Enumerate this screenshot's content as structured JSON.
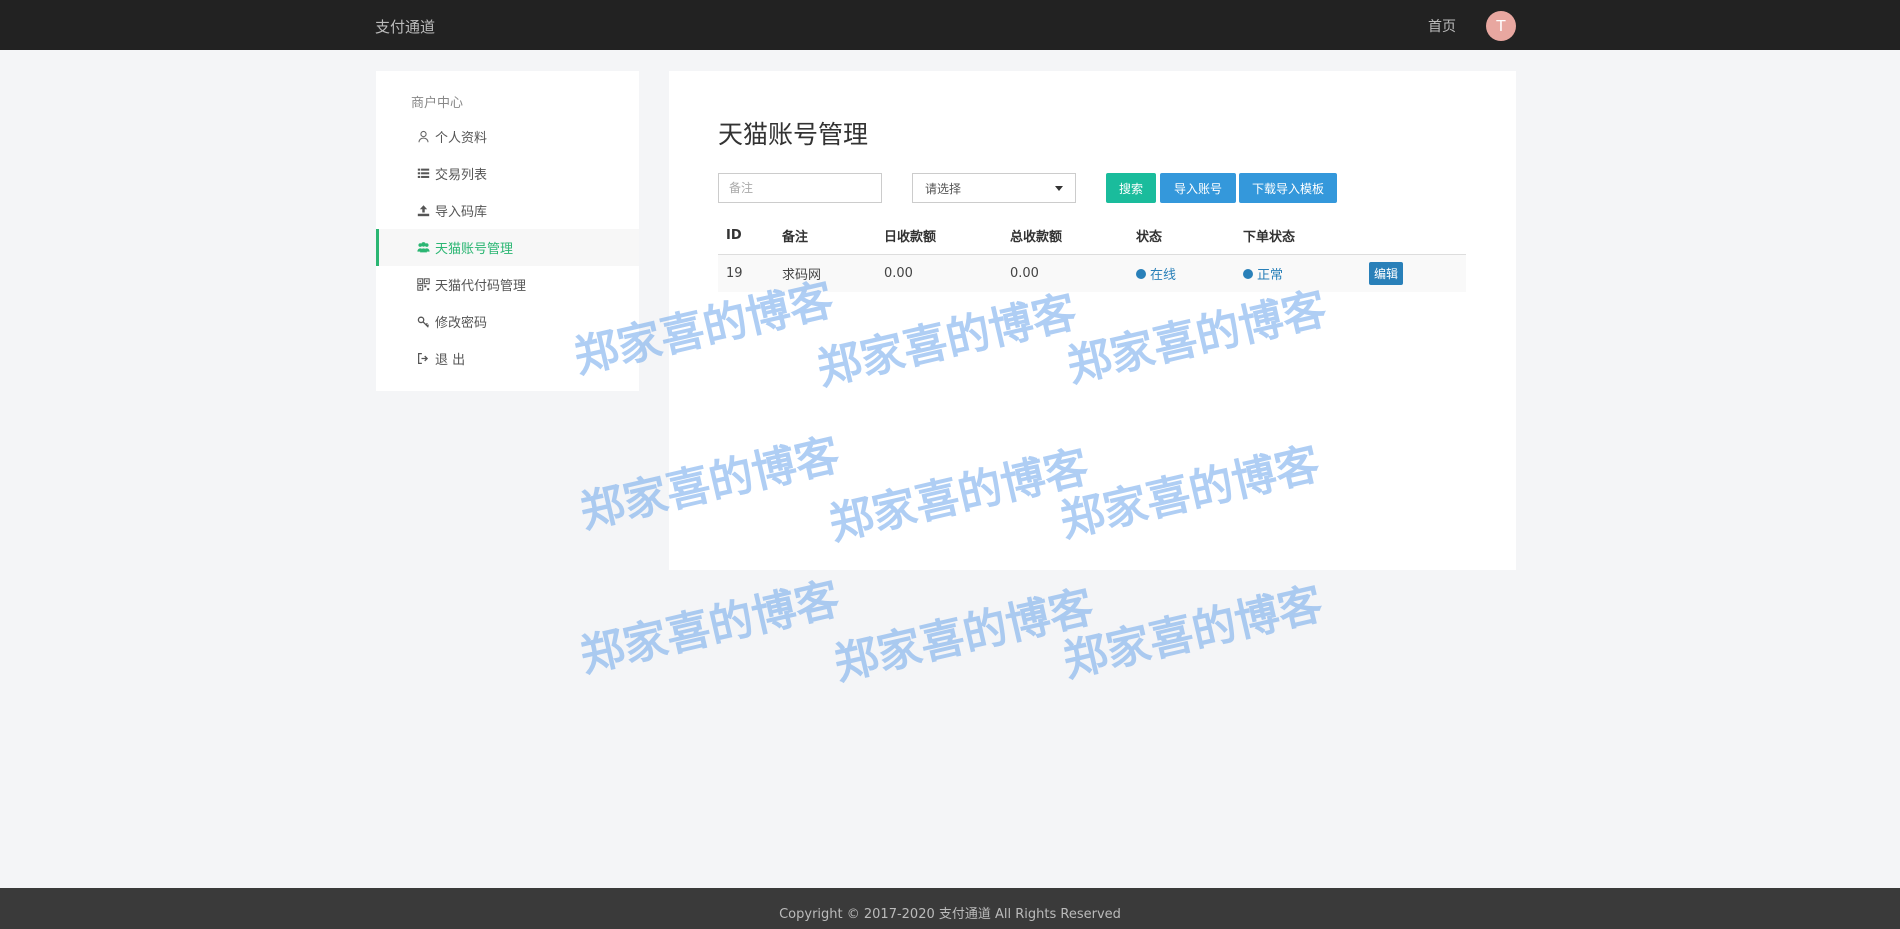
{
  "header": {
    "brand": "支付通道",
    "home": "首页",
    "avatar_letter": "T"
  },
  "sidebar": {
    "title": "商户中心",
    "items": [
      {
        "label": "个人资料",
        "icon": "user-icon"
      },
      {
        "label": "交易列表",
        "icon": "list-icon"
      },
      {
        "label": "导入码库",
        "icon": "upload-icon"
      },
      {
        "label": "天猫账号管理",
        "icon": "users-icon",
        "active": true
      },
      {
        "label": "天猫代付码管理",
        "icon": "qrcode-icon"
      },
      {
        "label": "修改密码",
        "icon": "key-icon"
      },
      {
        "label": "退 出",
        "icon": "logout-icon"
      }
    ]
  },
  "main": {
    "title": "天猫账号管理",
    "search_placeholder": "备注",
    "select_value": "请选择",
    "buttons": {
      "search": "搜索",
      "import": "导入账号",
      "template": "下载导入模板"
    },
    "table": {
      "headers": [
        "ID",
        "备注",
        "日收款额",
        "总收款额",
        "状态",
        "下单状态",
        ""
      ],
      "rows": [
        {
          "id": "19",
          "note": "求码网",
          "daily": "0.00",
          "total": "0.00",
          "status": "在线",
          "order_status": "正常",
          "action": "编辑"
        }
      ]
    }
  },
  "footer": {
    "copyright": "Copyright © 2017-2020 支付通道 All Rights Reserved"
  },
  "watermark": {
    "text": "郑家喜的博客"
  },
  "colors": {
    "accent_green": "#2bb673",
    "primary_blue": "#3498db",
    "teal": "#1abc9c",
    "status_blue": "#2980b9"
  }
}
